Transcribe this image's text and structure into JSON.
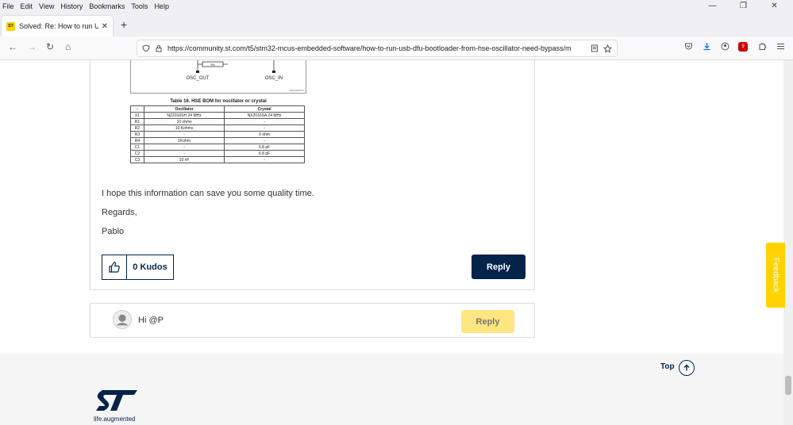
{
  "menu": [
    "File",
    "Edit",
    "View",
    "History",
    "Bookmarks",
    "Tools",
    "Help"
  ],
  "window_controls": {
    "minimize": "—",
    "restore": "❐",
    "close": "✕"
  },
  "tab": {
    "favicon": "ST",
    "title": "Solved: Re: How to run USB DF",
    "close": "✕",
    "new_tab": "+"
  },
  "nav": {
    "back": "←",
    "forward": "→",
    "reload": "↻",
    "home": "⌂"
  },
  "url": "https://community.st.com/t5/stm32-mcus-embedded-software/how-to-run-usb-dfu-bootloader-from-hse-oscillator-need-bypass/m",
  "badge_count": "9",
  "post": {
    "diagram_labels": {
      "osc_out": "OSC_OUT",
      "osc_in": "OSC_IN",
      "resistor": "R4",
      "ref": "MSv41427V1"
    },
    "table_caption": "Table 16. HSE BOM for oscillator or crystal",
    "table_headers": [
      "-",
      "Oscillator",
      "Crystal"
    ],
    "table_rows": [
      [
        "X1",
        "NZ2016SH 24 MHz",
        "NX2016SA 24 MHz"
      ],
      [
        "R1",
        "10 ohms",
        "-"
      ],
      [
        "R2",
        "10 Kohms",
        "-"
      ],
      [
        "R3",
        "-",
        "0 ohm"
      ],
      [
        "R4",
        "1Kohm",
        "-"
      ],
      [
        "C1",
        "-",
        "6.8 pF"
      ],
      [
        "C2",
        "-",
        "6.8 pF"
      ],
      [
        "C3",
        "10 nF",
        "-"
      ]
    ],
    "text1": "I hope this information can save you some quality time.",
    "text2": "Regards,",
    "text3": "Pablo",
    "kudos": "0 Kudos",
    "reply": "Reply"
  },
  "reply_box": {
    "text": "Hi @P",
    "reply": "Reply"
  },
  "footer": {
    "top": "Top",
    "tagline": "life.augmented"
  },
  "feedback": "Feedback"
}
